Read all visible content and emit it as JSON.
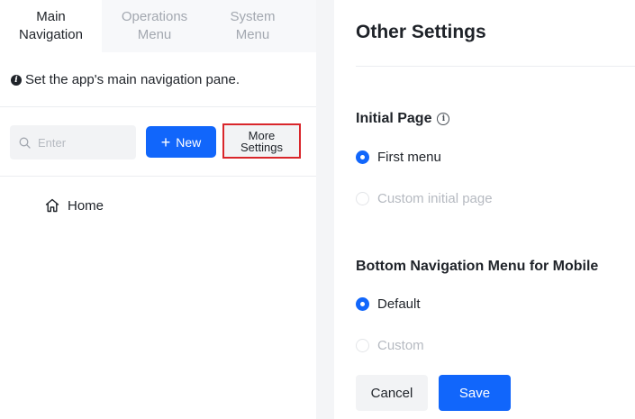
{
  "tabs": [
    {
      "label": "Main\nNavigation",
      "active": true
    },
    {
      "label": "Operations\nMenu",
      "active": false
    },
    {
      "label": "System\nMenu",
      "active": false
    }
  ],
  "info": {
    "text": "Set the app's main navigation pane.",
    "icon": "info-icon"
  },
  "search": {
    "placeholder": "Enter",
    "value": "",
    "icon": "search-icon"
  },
  "toolbar": {
    "new_label": "New",
    "more_label": "More\nSettings"
  },
  "nav_items": [
    {
      "label": "Home",
      "icon": "home-icon"
    }
  ],
  "settings": {
    "title": "Other Settings",
    "initial_page": {
      "title": "Initial Page",
      "options": [
        {
          "label": "First menu",
          "selected": true
        },
        {
          "label": "Custom initial page",
          "selected": false
        }
      ]
    },
    "bottom_nav": {
      "title": "Bottom Navigation Menu for Mobile",
      "options": [
        {
          "label": "Default",
          "selected": true
        },
        {
          "label": "Custom",
          "selected": false
        }
      ]
    },
    "cancel_label": "Cancel",
    "save_label": "Save"
  },
  "colors": {
    "accent": "#1166fb",
    "highlight_border": "#d9262b"
  }
}
